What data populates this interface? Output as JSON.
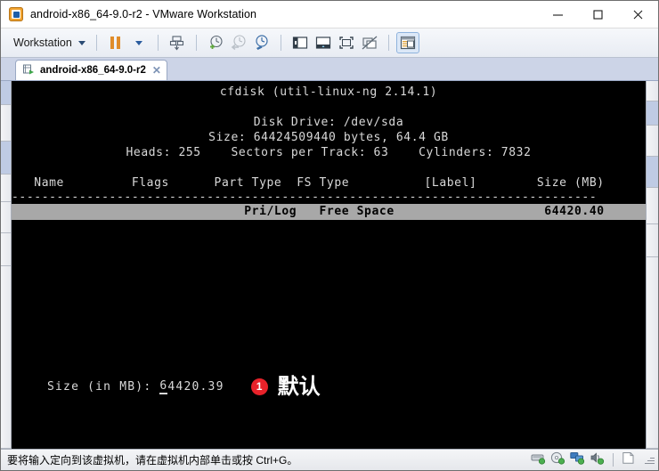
{
  "window": {
    "title": "android-x86_64-9.0-r2 - VMware Workstation",
    "app_icon": "vmware-icon",
    "controls": {
      "minimize": "minimize-button",
      "maximize": "maximize-button",
      "close": "close-button"
    }
  },
  "toolbar": {
    "menu_label": "Workstation",
    "buttons": [
      {
        "name": "pause-vm-button",
        "icon": "pause-icon"
      },
      {
        "name": "power-dropdown-button",
        "icon": "caret-down-icon"
      },
      {
        "name": "send-ctrl-alt-del-button",
        "icon": "keyboard-send-icon"
      },
      {
        "name": "take-snapshot-button",
        "icon": "snapshot-add-icon"
      },
      {
        "name": "revert-snapshot-button",
        "icon": "snapshot-revert-icon"
      },
      {
        "name": "snapshot-manager-button",
        "icon": "snapshot-manager-icon"
      },
      {
        "name": "show-library-button",
        "icon": "library-panel-icon"
      },
      {
        "name": "show-thumbnail-bar-button",
        "icon": "thumbnail-bar-icon"
      },
      {
        "name": "fullscreen-button",
        "icon": "fullscreen-icon"
      },
      {
        "name": "unity-mode-button",
        "icon": "unity-mode-icon"
      },
      {
        "name": "console-view-button",
        "icon": "console-view-icon"
      }
    ]
  },
  "tabs": [
    {
      "label": "android-x86_64-9.0-r2",
      "icon": "vm-tab-icon",
      "close_label": "✕",
      "active": true
    }
  ],
  "console": {
    "title_line": "cfdisk (util-linux-ng 2.14.1)",
    "disk_drive_line": "Disk Drive: /dev/sda",
    "size_line": "Size: 64424509440 bytes, 64.4 GB",
    "geometry_line": "Heads: 255    Sectors per Track: 63    Cylinders: 7832",
    "columns_line": "   Name         Flags      Part Type  FS Type          [Label]        Size (MB)",
    "divider_line": "------------------------------------------------------------------------------",
    "selected_row": {
      "part_type": "Pri/Log",
      "fs_type": "Free Space",
      "size_mb": "64420.40",
      "line": "                               Pri/Log   Free Space                    64420.40"
    },
    "prompt": {
      "label": "Size (in MB): ",
      "value_cursor": "6",
      "value_rest": "4420.39"
    },
    "annotation": {
      "badge": "1",
      "text": "默认"
    }
  },
  "statusbar": {
    "message": "要将输入定向到该虚拟机，请在虚拟机内部单击或按 Ctrl+G。",
    "devices": [
      {
        "name": "hard-disk-status-icon"
      },
      {
        "name": "cd-dvd-status-icon"
      },
      {
        "name": "network-adapter-status-icon"
      },
      {
        "name": "sound-card-status-icon"
      }
    ],
    "message_icon": "message-log-icon",
    "resize_grip": "resize-grip"
  },
  "colors": {
    "accent": "#e8222a",
    "terminal_bg": "#000000",
    "terminal_fg": "#d9d9d9",
    "selection_bg": "#a8a8a8",
    "tabstrip_bg": "#ccd4e7"
  }
}
